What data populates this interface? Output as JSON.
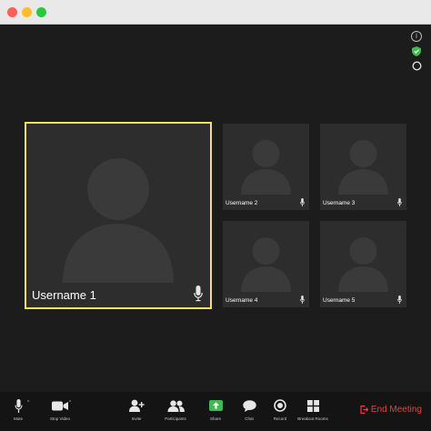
{
  "window": {
    "controls": [
      "close",
      "minimize",
      "maximize"
    ]
  },
  "side_icons": [
    "info-icon",
    "shield-icon",
    "record-dot-icon"
  ],
  "participants": [
    {
      "name": "Username 1",
      "active_speaker": true
    },
    {
      "name": "Username 2",
      "active_speaker": false
    },
    {
      "name": "Username 3",
      "active_speaker": false
    },
    {
      "name": "Username 4",
      "active_speaker": false
    },
    {
      "name": "Username 5",
      "active_speaker": false
    }
  ],
  "toolbar": {
    "mute": "Mute",
    "stop_video": "Stop Video",
    "invite": "Invite",
    "participants": "Participants",
    "share": "Share",
    "chat": "Chat",
    "record": "Record",
    "breakout_rooms": "Breakout Rooms",
    "end_meeting": "End Meeting"
  },
  "colors": {
    "active_border": "#f2e35a",
    "share_green": "#3fb950",
    "end_red": "#e8413a",
    "tile_bg": "#2d2d2d"
  }
}
